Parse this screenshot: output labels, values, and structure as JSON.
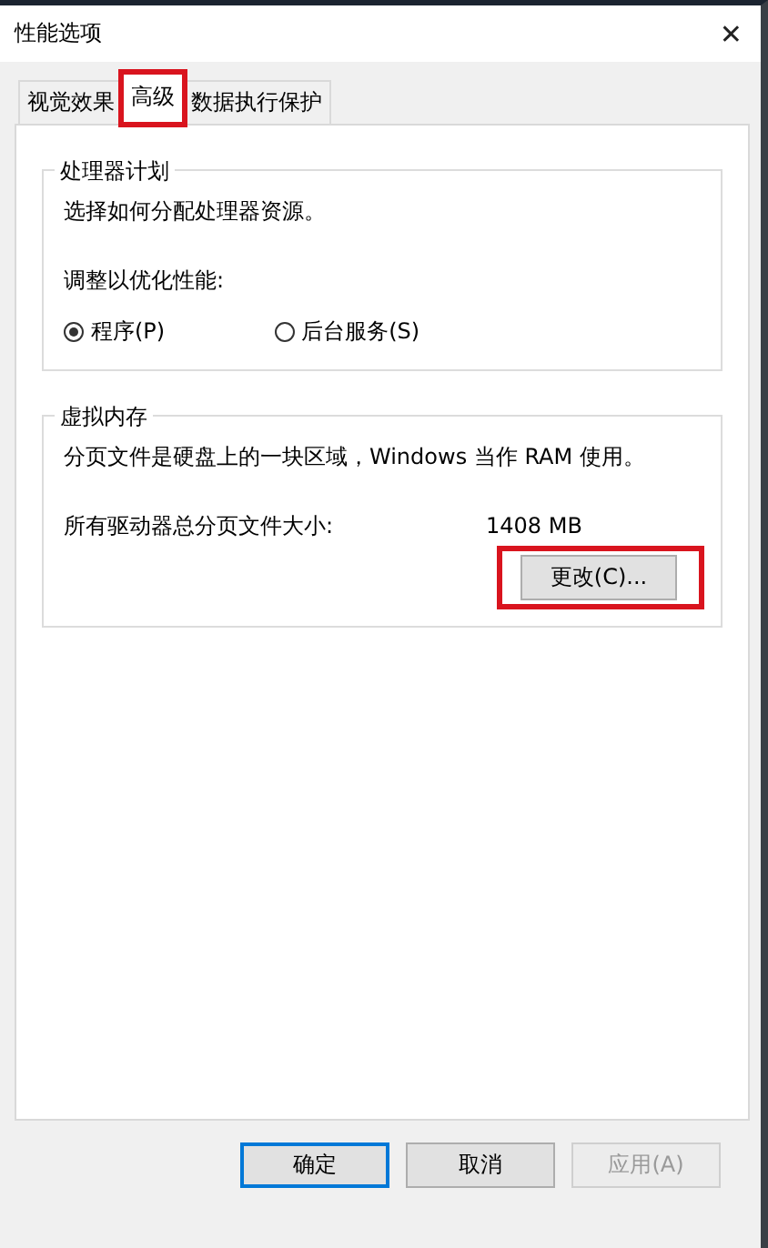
{
  "window": {
    "title": "性能选项",
    "close": "✕"
  },
  "tabs": [
    {
      "label": "视觉效果",
      "selected": false,
      "highlighted": false
    },
    {
      "label": "高级",
      "selected": true,
      "highlighted": true
    },
    {
      "label": "数据执行保护",
      "selected": false,
      "highlighted": false
    }
  ],
  "processor_group": {
    "title": "处理器计划",
    "description": "选择如何分配处理器资源。",
    "prompt": "调整以优化性能:",
    "options": [
      {
        "label": "程序(P)",
        "selected": true
      },
      {
        "label": "后台服务(S)",
        "selected": false
      }
    ]
  },
  "memory_group": {
    "title": "虚拟内存",
    "description": "分页文件是硬盘上的一块区域，Windows 当作 RAM 使用。",
    "size_label": "所有驱动器总分页文件大小:",
    "size_value": "1408 MB",
    "change_button": {
      "label": "更改(C)...",
      "highlighted": true
    }
  },
  "buttons": [
    {
      "label": "确定",
      "default": true,
      "disabled": false
    },
    {
      "label": "取消",
      "default": false,
      "disabled": false
    },
    {
      "label": "应用(A)",
      "default": false,
      "disabled": true
    }
  ]
}
